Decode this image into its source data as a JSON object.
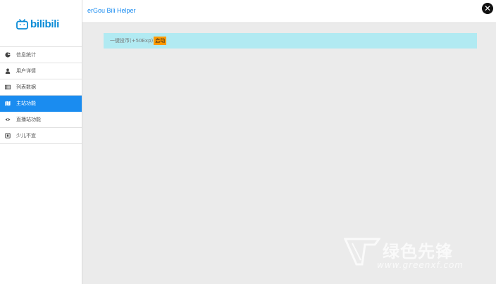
{
  "header": {
    "title": "erGou Bili Helper"
  },
  "logo": {
    "text": "bilibili"
  },
  "sidebar": {
    "items": [
      {
        "label": "信息统计",
        "icon": "pie-chart-icon",
        "active": false
      },
      {
        "label": "用户详情",
        "icon": "user-icon",
        "active": false
      },
      {
        "label": "列表数据",
        "icon": "table-icon",
        "active": false
      },
      {
        "label": "主站功能",
        "icon": "map-icon",
        "active": true
      },
      {
        "label": "直播站功能",
        "icon": "eye-icon",
        "active": false
      },
      {
        "label": "少儿不宜",
        "icon": "warning-icon",
        "active": false
      }
    ]
  },
  "notice": {
    "text": "一键投币(+50Exp)",
    "button_label": "启动"
  },
  "watermark": {
    "text": "绿色先锋",
    "url": "www.greenxf.com"
  },
  "colors": {
    "accent": "#1a8cf0",
    "notice_bg": "#b1eaf2",
    "button_orange": "#ff9900"
  }
}
